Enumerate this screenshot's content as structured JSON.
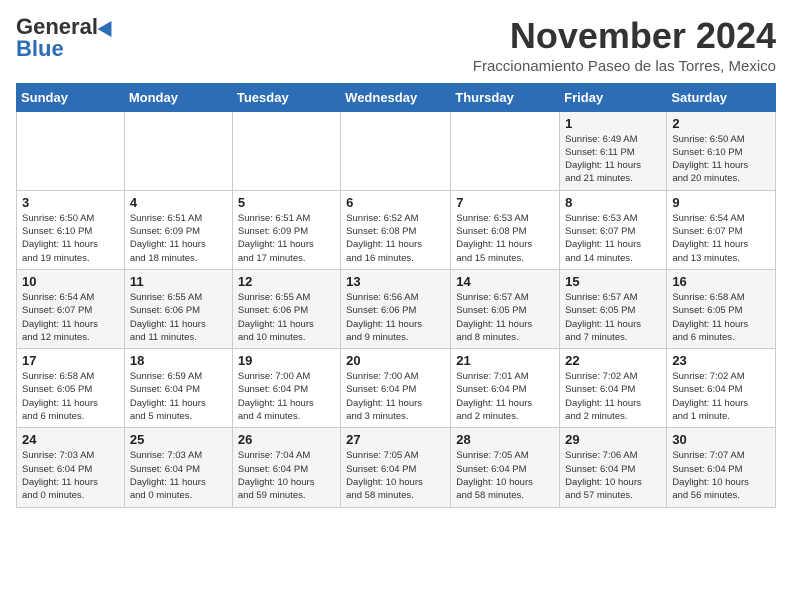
{
  "header": {
    "logo_general": "General",
    "logo_blue": "Blue",
    "month": "November 2024",
    "location": "Fraccionamiento Paseo de las Torres, Mexico"
  },
  "weekdays": [
    "Sunday",
    "Monday",
    "Tuesday",
    "Wednesday",
    "Thursday",
    "Friday",
    "Saturday"
  ],
  "weeks": [
    [
      {
        "day": "",
        "info": ""
      },
      {
        "day": "",
        "info": ""
      },
      {
        "day": "",
        "info": ""
      },
      {
        "day": "",
        "info": ""
      },
      {
        "day": "",
        "info": ""
      },
      {
        "day": "1",
        "info": "Sunrise: 6:49 AM\nSunset: 6:11 PM\nDaylight: 11 hours\nand 21 minutes."
      },
      {
        "day": "2",
        "info": "Sunrise: 6:50 AM\nSunset: 6:10 PM\nDaylight: 11 hours\nand 20 minutes."
      }
    ],
    [
      {
        "day": "3",
        "info": "Sunrise: 6:50 AM\nSunset: 6:10 PM\nDaylight: 11 hours\nand 19 minutes."
      },
      {
        "day": "4",
        "info": "Sunrise: 6:51 AM\nSunset: 6:09 PM\nDaylight: 11 hours\nand 18 minutes."
      },
      {
        "day": "5",
        "info": "Sunrise: 6:51 AM\nSunset: 6:09 PM\nDaylight: 11 hours\nand 17 minutes."
      },
      {
        "day": "6",
        "info": "Sunrise: 6:52 AM\nSunset: 6:08 PM\nDaylight: 11 hours\nand 16 minutes."
      },
      {
        "day": "7",
        "info": "Sunrise: 6:53 AM\nSunset: 6:08 PM\nDaylight: 11 hours\nand 15 minutes."
      },
      {
        "day": "8",
        "info": "Sunrise: 6:53 AM\nSunset: 6:07 PM\nDaylight: 11 hours\nand 14 minutes."
      },
      {
        "day": "9",
        "info": "Sunrise: 6:54 AM\nSunset: 6:07 PM\nDaylight: 11 hours\nand 13 minutes."
      }
    ],
    [
      {
        "day": "10",
        "info": "Sunrise: 6:54 AM\nSunset: 6:07 PM\nDaylight: 11 hours\nand 12 minutes."
      },
      {
        "day": "11",
        "info": "Sunrise: 6:55 AM\nSunset: 6:06 PM\nDaylight: 11 hours\nand 11 minutes."
      },
      {
        "day": "12",
        "info": "Sunrise: 6:55 AM\nSunset: 6:06 PM\nDaylight: 11 hours\nand 10 minutes."
      },
      {
        "day": "13",
        "info": "Sunrise: 6:56 AM\nSunset: 6:06 PM\nDaylight: 11 hours\nand 9 minutes."
      },
      {
        "day": "14",
        "info": "Sunrise: 6:57 AM\nSunset: 6:05 PM\nDaylight: 11 hours\nand 8 minutes."
      },
      {
        "day": "15",
        "info": "Sunrise: 6:57 AM\nSunset: 6:05 PM\nDaylight: 11 hours\nand 7 minutes."
      },
      {
        "day": "16",
        "info": "Sunrise: 6:58 AM\nSunset: 6:05 PM\nDaylight: 11 hours\nand 6 minutes."
      }
    ],
    [
      {
        "day": "17",
        "info": "Sunrise: 6:58 AM\nSunset: 6:05 PM\nDaylight: 11 hours\nand 6 minutes."
      },
      {
        "day": "18",
        "info": "Sunrise: 6:59 AM\nSunset: 6:04 PM\nDaylight: 11 hours\nand 5 minutes."
      },
      {
        "day": "19",
        "info": "Sunrise: 7:00 AM\nSunset: 6:04 PM\nDaylight: 11 hours\nand 4 minutes."
      },
      {
        "day": "20",
        "info": "Sunrise: 7:00 AM\nSunset: 6:04 PM\nDaylight: 11 hours\nand 3 minutes."
      },
      {
        "day": "21",
        "info": "Sunrise: 7:01 AM\nSunset: 6:04 PM\nDaylight: 11 hours\nand 2 minutes."
      },
      {
        "day": "22",
        "info": "Sunrise: 7:02 AM\nSunset: 6:04 PM\nDaylight: 11 hours\nand 2 minutes."
      },
      {
        "day": "23",
        "info": "Sunrise: 7:02 AM\nSunset: 6:04 PM\nDaylight: 11 hours\nand 1 minute."
      }
    ],
    [
      {
        "day": "24",
        "info": "Sunrise: 7:03 AM\nSunset: 6:04 PM\nDaylight: 11 hours\nand 0 minutes."
      },
      {
        "day": "25",
        "info": "Sunrise: 7:03 AM\nSunset: 6:04 PM\nDaylight: 11 hours\nand 0 minutes."
      },
      {
        "day": "26",
        "info": "Sunrise: 7:04 AM\nSunset: 6:04 PM\nDaylight: 10 hours\nand 59 minutes."
      },
      {
        "day": "27",
        "info": "Sunrise: 7:05 AM\nSunset: 6:04 PM\nDaylight: 10 hours\nand 58 minutes."
      },
      {
        "day": "28",
        "info": "Sunrise: 7:05 AM\nSunset: 6:04 PM\nDaylight: 10 hours\nand 58 minutes."
      },
      {
        "day": "29",
        "info": "Sunrise: 7:06 AM\nSunset: 6:04 PM\nDaylight: 10 hours\nand 57 minutes."
      },
      {
        "day": "30",
        "info": "Sunrise: 7:07 AM\nSunset: 6:04 PM\nDaylight: 10 hours\nand 56 minutes."
      }
    ]
  ]
}
